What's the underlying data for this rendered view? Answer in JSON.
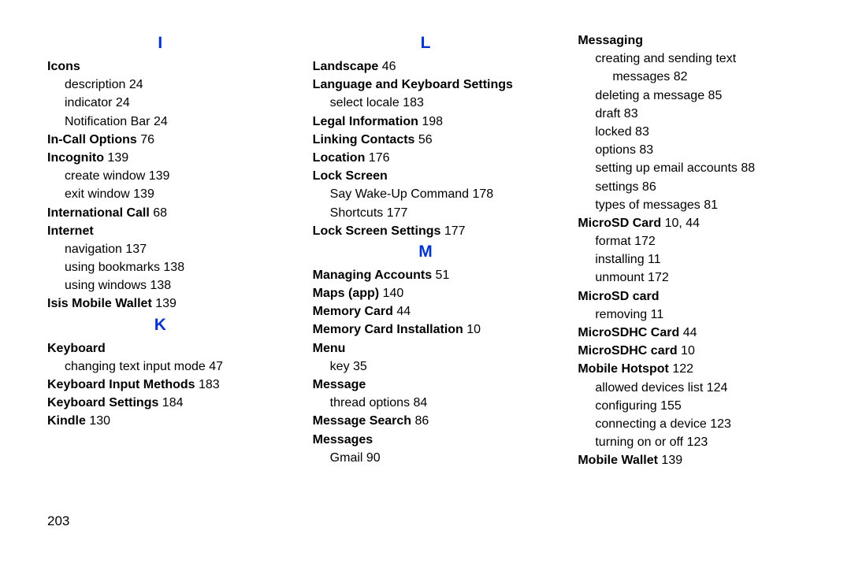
{
  "page_number": "203",
  "columns": [
    {
      "items": [
        {
          "type": "letter",
          "text": "I"
        },
        {
          "type": "main",
          "label": "Icons",
          "page": ""
        },
        {
          "type": "sub",
          "label": "description",
          "page": "24"
        },
        {
          "type": "sub",
          "label": "indicator",
          "page": "24"
        },
        {
          "type": "sub",
          "label": "Notification Bar",
          "page": "24"
        },
        {
          "type": "main",
          "label": "In-Call Options",
          "page": "76"
        },
        {
          "type": "main",
          "label": "Incognito",
          "page": "139"
        },
        {
          "type": "sub",
          "label": "create window",
          "page": "139"
        },
        {
          "type": "sub",
          "label": "exit window",
          "page": "139"
        },
        {
          "type": "main",
          "label": "International Call",
          "page": "68"
        },
        {
          "type": "main",
          "label": "Internet",
          "page": ""
        },
        {
          "type": "sub",
          "label": "navigation",
          "page": "137"
        },
        {
          "type": "sub",
          "label": "using bookmarks",
          "page": "138"
        },
        {
          "type": "sub",
          "label": "using windows",
          "page": "138"
        },
        {
          "type": "main",
          "label": "Isis Mobile Wallet",
          "page": "139"
        },
        {
          "type": "letter",
          "text": "K"
        },
        {
          "type": "main",
          "label": "Keyboard",
          "page": ""
        },
        {
          "type": "sub",
          "label": "changing text input mode",
          "page": "47"
        },
        {
          "type": "main",
          "label": "Keyboard Input Methods",
          "page": "183"
        },
        {
          "type": "main",
          "label": "Keyboard Settings",
          "page": "184"
        },
        {
          "type": "main",
          "label": "Kindle",
          "page": "130"
        }
      ]
    },
    {
      "items": [
        {
          "type": "letter",
          "text": "L"
        },
        {
          "type": "main",
          "label": "Landscape",
          "page": "46"
        },
        {
          "type": "main",
          "label": "Language and Keyboard Settings",
          "page": ""
        },
        {
          "type": "sub",
          "label": "select locale",
          "page": "183"
        },
        {
          "type": "main",
          "label": "Legal Information",
          "page": "198"
        },
        {
          "type": "main",
          "label": "Linking Contacts",
          "page": "56"
        },
        {
          "type": "main",
          "label": "Location",
          "page": "176"
        },
        {
          "type": "main",
          "label": "Lock Screen",
          "page": ""
        },
        {
          "type": "sub",
          "label": "Say Wake-Up Command",
          "page": "178"
        },
        {
          "type": "sub",
          "label": "Shortcuts",
          "page": "177"
        },
        {
          "type": "main",
          "label": "Lock Screen Settings",
          "page": "177"
        },
        {
          "type": "letter",
          "text": "M"
        },
        {
          "type": "main",
          "label": "Managing Accounts",
          "page": "51"
        },
        {
          "type": "main",
          "label": "Maps (app)",
          "page": "140"
        },
        {
          "type": "main",
          "label": "Memory Card",
          "page": "44"
        },
        {
          "type": "main",
          "label": "Memory Card Installation",
          "page": "10"
        },
        {
          "type": "main",
          "label": "Menu",
          "page": ""
        },
        {
          "type": "sub",
          "label": "key",
          "page": "35"
        },
        {
          "type": "main",
          "label": "Message",
          "page": ""
        },
        {
          "type": "sub",
          "label": "thread options",
          "page": "84"
        },
        {
          "type": "main",
          "label": "Message Search",
          "page": "86"
        },
        {
          "type": "main",
          "label": "Messages",
          "page": ""
        },
        {
          "type": "sub",
          "label": "Gmail",
          "page": "90"
        }
      ]
    },
    {
      "items": [
        {
          "type": "main",
          "label": "Messaging",
          "page": ""
        },
        {
          "type": "sub",
          "label": "creating and sending text",
          "page": ""
        },
        {
          "type": "sub2",
          "label": "messages",
          "page": "82"
        },
        {
          "type": "sub",
          "label": "deleting a message",
          "page": "85"
        },
        {
          "type": "sub",
          "label": "draft",
          "page": "83"
        },
        {
          "type": "sub",
          "label": "locked",
          "page": "83"
        },
        {
          "type": "sub",
          "label": "options",
          "page": "83"
        },
        {
          "type": "sub",
          "label": "setting up email accounts",
          "page": "88"
        },
        {
          "type": "sub",
          "label": "settings",
          "page": "86"
        },
        {
          "type": "sub",
          "label": "types of messages",
          "page": "81"
        },
        {
          "type": "main",
          "label": "MicroSD Card",
          "page": "10, 44"
        },
        {
          "type": "sub",
          "label": "format",
          "page": "172"
        },
        {
          "type": "sub",
          "label": "installing",
          "page": "11"
        },
        {
          "type": "sub",
          "label": "unmount",
          "page": "172"
        },
        {
          "type": "main",
          "label": "MicroSD card",
          "page": ""
        },
        {
          "type": "sub",
          "label": "removing",
          "page": "11"
        },
        {
          "type": "main",
          "label": "MicroSDHC Card",
          "page": "44"
        },
        {
          "type": "main",
          "label": "MicroSDHC card",
          "page": "10"
        },
        {
          "type": "main",
          "label": "Mobile Hotspot",
          "page": "122"
        },
        {
          "type": "sub",
          "label": "allowed devices list",
          "page": "124"
        },
        {
          "type": "sub",
          "label": "configuring",
          "page": "155"
        },
        {
          "type": "sub",
          "label": "connecting a device",
          "page": "123"
        },
        {
          "type": "sub",
          "label": "turning on or off",
          "page": "123"
        },
        {
          "type": "main",
          "label": "Mobile Wallet",
          "page": "139"
        }
      ]
    }
  ]
}
